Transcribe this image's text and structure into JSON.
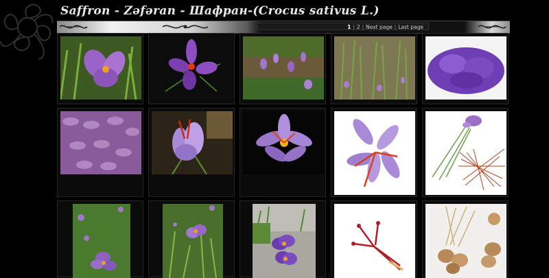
{
  "title": "Saffron - Zəfəran - Шафран-(Crocus sativus L.)",
  "pager": {
    "pages": [
      "1",
      "2"
    ],
    "current": "1",
    "next_label": "Next page",
    "last_label": "Last page"
  },
  "gallery": {
    "rows": 3,
    "columns": 5,
    "thumbnails": [
      {
        "subject": "purple crocus flower in grass"
      },
      {
        "subject": "purple crocus flower on dark background"
      },
      {
        "subject": "crocus plants in soil"
      },
      {
        "subject": "crocus field with green leaves"
      },
      {
        "subject": "pile of harvested purple crocus flowers"
      },
      {
        "subject": "many purple crocus petals close-up"
      },
      {
        "subject": "lilac crocus with red stigmas"
      },
      {
        "subject": "open crocus flower on black background"
      },
      {
        "subject": "crocus flower on white background"
      },
      {
        "subject": "crocus illustration with dried saffron threads"
      },
      {
        "subject": "crocus flowers in green meadow"
      },
      {
        "subject": "crocus flower in garden"
      },
      {
        "subject": "purple crocus flowers in gravel"
      },
      {
        "subject": "red saffron stigmas on white"
      },
      {
        "subject": "crocus corms with roots"
      }
    ]
  }
}
